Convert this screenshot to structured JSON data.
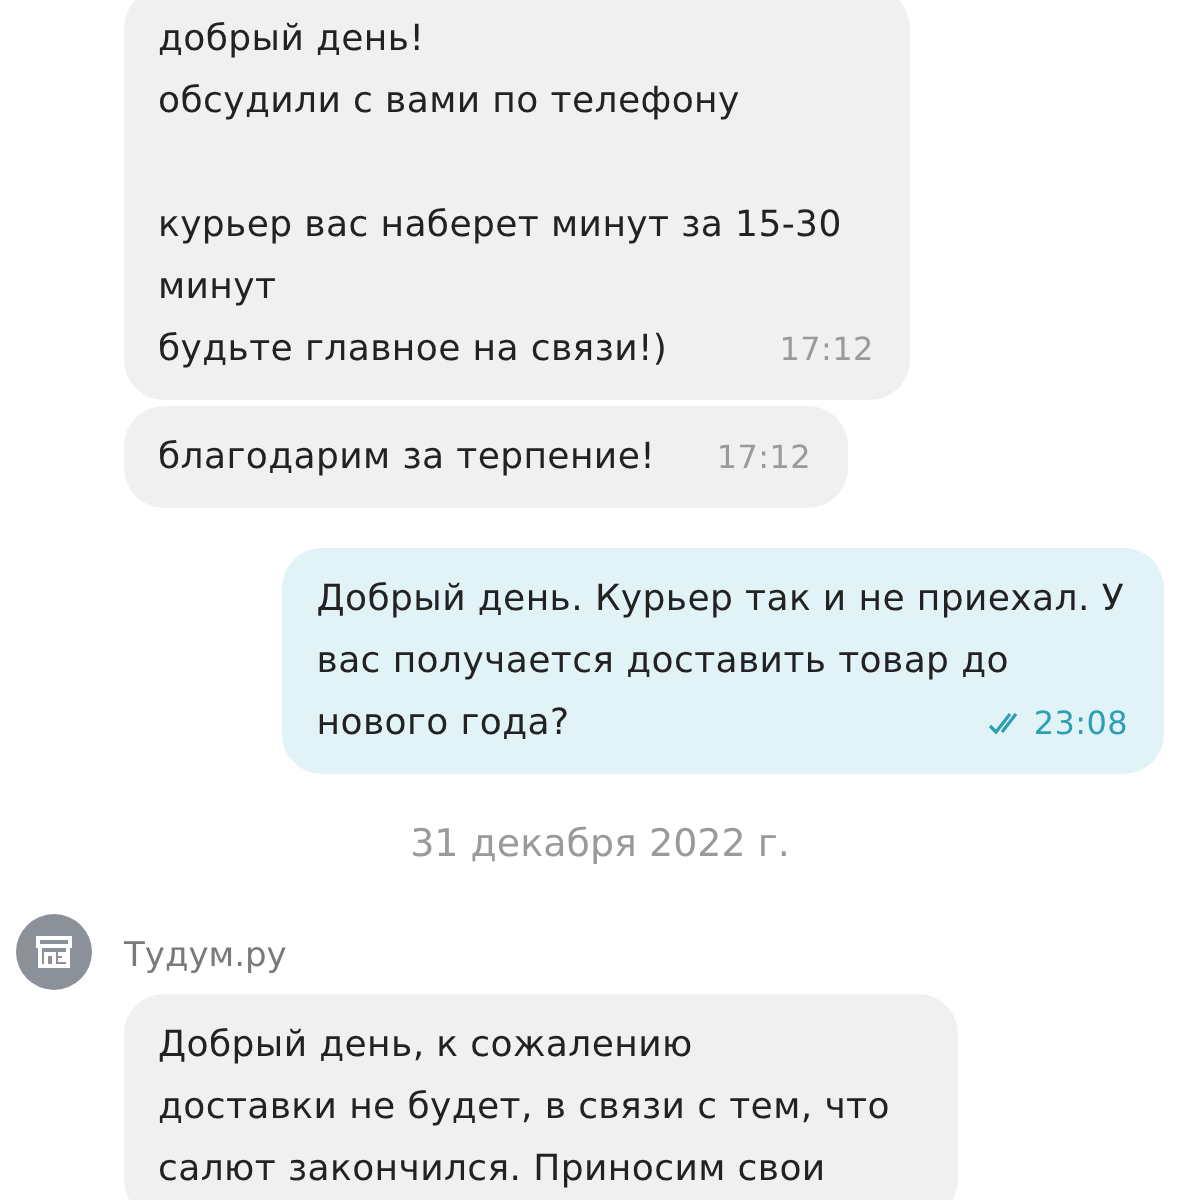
{
  "messages": [
    {
      "kind": "incoming",
      "text": "добрый день!\nобсудили с вами по телефону\n\nкурьер вас наберет минут за 15-30\nминут\nбудьте главное на связи!)",
      "time": "17:12"
    },
    {
      "kind": "incoming",
      "text": "благодарим за терпение!",
      "time": "17:12"
    },
    {
      "kind": "outgoing",
      "text": "Добрый день. Курьер так и не приехал. У\nвас получается доставить товар до\nнового года?",
      "time": "23:08",
      "read": true
    },
    {
      "kind": "date",
      "text": "31 декабря 2022 г."
    },
    {
      "kind": "sender",
      "name": "Тудум.ру"
    },
    {
      "kind": "incoming",
      "text": "Добрый день, к сожалению\nдоставки не будет, в связи с тем, что\nсалют закончился. Приносим свои"
    }
  ]
}
